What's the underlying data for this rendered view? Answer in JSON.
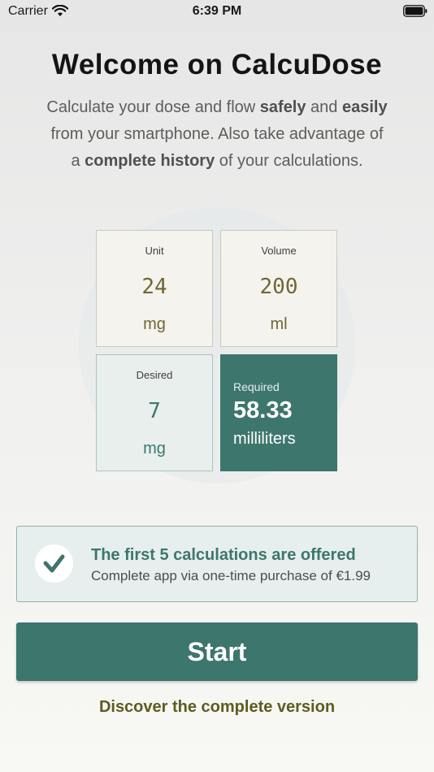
{
  "status_bar": {
    "carrier": "Carrier",
    "time": "6:39 PM"
  },
  "header": {
    "title": "Welcome on CalcuDose",
    "intro_lines": [
      [
        "Calculate your dose and flow ",
        "safely",
        " and ",
        "easily"
      ],
      [
        "from your smartphone. Also take advantage of"
      ],
      [
        "a ",
        "complete history",
        " of your calculations."
      ]
    ]
  },
  "example": {
    "unit": {
      "label": "Unit",
      "value": "24",
      "unit": "mg"
    },
    "volume": {
      "label": "Volume",
      "value": "200",
      "unit": "ml"
    },
    "desired": {
      "label": "Desired",
      "value": "7",
      "unit": "mg"
    },
    "required": {
      "label": "Required",
      "value": "58.33",
      "unit": "milliliters"
    }
  },
  "offer": {
    "title": "The first 5 calculations are offered",
    "subtitle": "Complete app via one-time purchase of €1.99",
    "icon": "checkmark-icon"
  },
  "actions": {
    "start_label": "Start",
    "discover_label": "Discover the complete version"
  },
  "colors": {
    "accent": "#3d766d",
    "olive": "#6f6735",
    "link": "#5f5b20",
    "mint": "#e8efed",
    "cream": "#f5f3ed"
  }
}
